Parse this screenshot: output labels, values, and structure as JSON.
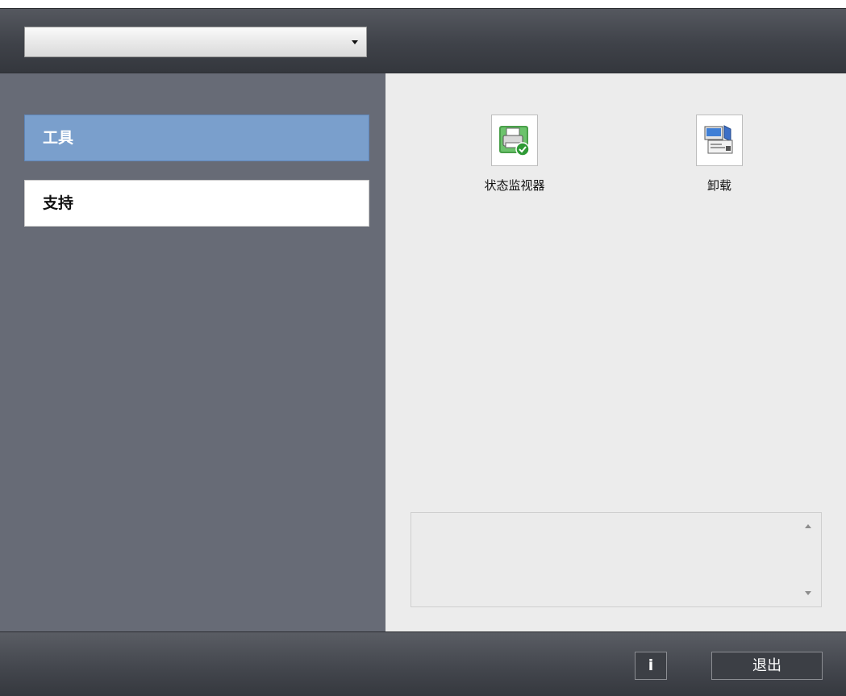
{
  "header": {
    "dropdown": {
      "selected_value": ""
    }
  },
  "sidebar": {
    "items": [
      {
        "label": "工具",
        "selected": true
      },
      {
        "label": "支持",
        "selected": false
      }
    ]
  },
  "main": {
    "tools": [
      {
        "label": "状态监视器",
        "icon": "status-monitor-icon"
      },
      {
        "label": "卸载",
        "icon": "uninstall-icon"
      }
    ],
    "description_box": {
      "text": ""
    }
  },
  "footer": {
    "info_label": "i",
    "exit_label": "退出"
  },
  "colors": {
    "selected_nav": "#7a9fcc",
    "sidebar_bg": "#676b76",
    "content_bg": "#ececec",
    "header_bg": "#3f4249"
  }
}
